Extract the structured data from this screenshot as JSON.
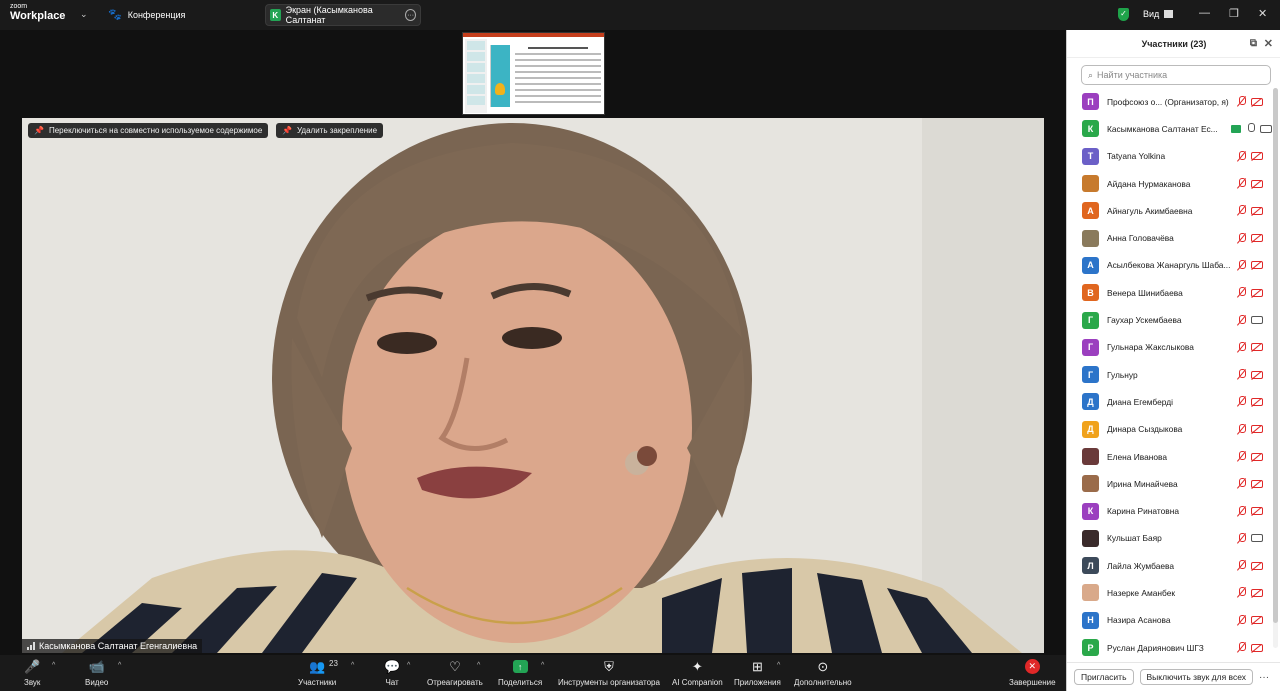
{
  "app": {
    "brand_top": "zoom",
    "brand_bottom": "Workplace",
    "meeting_label": "Конференция",
    "screen_tab_initial": "K",
    "screen_tab_label": "Экран (Касымканова Салтанат",
    "view_label": "Вид"
  },
  "video": {
    "switch_label": "Переключиться на совместно используемое содержимое",
    "unpin_label": "Удалить закрепление",
    "speaker_name": "Касымканова Салтанат Егенгалиевна"
  },
  "toolbar": {
    "audio": "Звук",
    "video": "Видео",
    "participants": "Участники",
    "participants_count": "23",
    "chat": "Чат",
    "react": "Отреагировать",
    "share": "Поделиться",
    "host_tools": "Инструменты организатора",
    "ai": "AI Companion",
    "apps": "Приложения",
    "more": "Дополнительно",
    "end": "Завершение"
  },
  "panel": {
    "title": "Участники (23)",
    "search_placeholder": "Найти участника",
    "invite": "Пригласить",
    "mute_all": "Выключить звук для всех",
    "participants": [
      {
        "initial": "П",
        "color": "#9b3fbf",
        "name": "Профсоюз о... (Организатор, я)",
        "mic": "off",
        "cam": "off"
      },
      {
        "initial": "К",
        "color": "#2aa84a",
        "name": "Касымканова Салтанат Ес...",
        "mic": "on",
        "cam": "on",
        "sharing": true
      },
      {
        "initial": "T",
        "color": "#6b5fc7",
        "name": "Tatyana Yolkina",
        "mic": "off",
        "cam": "off"
      },
      {
        "initial": "",
        "color": "#c77a2d",
        "name": "Айдана Нурмаканова",
        "mic": "off",
        "cam": "off",
        "photo": true
      },
      {
        "initial": "А",
        "color": "#e0661f",
        "name": "Айнагуль Акимбаевна",
        "mic": "off",
        "cam": "off"
      },
      {
        "initial": "",
        "color": "#8a7a5c",
        "name": "Анна Головачёва",
        "mic": "off",
        "cam": "off",
        "photo": true
      },
      {
        "initial": "А",
        "color": "#2c74c9",
        "name": "Асылбекова Жанаргуль Шаба...",
        "mic": "off",
        "cam": "off"
      },
      {
        "initial": "В",
        "color": "#e0661f",
        "name": "Венера Шинибаева",
        "mic": "off",
        "cam": "off"
      },
      {
        "initial": "Г",
        "color": "#2aa84a",
        "name": "Гаухар Ускембаева",
        "mic": "off",
        "cam": "on"
      },
      {
        "initial": "Г",
        "color": "#9b3fbf",
        "name": "Гульнара Жакслыкова",
        "mic": "off",
        "cam": "off"
      },
      {
        "initial": "Г",
        "color": "#2c74c9",
        "name": "Гульнур",
        "mic": "off",
        "cam": "off"
      },
      {
        "initial": "Д",
        "color": "#2c74c9",
        "name": "Диана Егемберді",
        "mic": "off",
        "cam": "off"
      },
      {
        "initial": "Д",
        "color": "#f0a21c",
        "name": "Динара Сыздыкова",
        "mic": "off",
        "cam": "off"
      },
      {
        "initial": "",
        "color": "#6a3a3a",
        "name": "Елена Иванова",
        "mic": "off",
        "cam": "off",
        "photo": true
      },
      {
        "initial": "",
        "color": "#9a6b4a",
        "name": "Ирина Минайчева",
        "mic": "off",
        "cam": "off",
        "photo": true
      },
      {
        "initial": "К",
        "color": "#9b3fbf",
        "name": "Карина Ринатовна",
        "mic": "off",
        "cam": "off"
      },
      {
        "initial": "",
        "color": "#3a2a2a",
        "name": "Кульшат Баяр",
        "mic": "off",
        "cam": "on",
        "photo": true
      },
      {
        "initial": "Л",
        "color": "#3c4a5a",
        "name": "Лайла Жумбаева",
        "mic": "off",
        "cam": "off"
      },
      {
        "initial": "",
        "color": "#d9a98a",
        "name": "Назерке Аманбек",
        "mic": "off",
        "cam": "off",
        "photo": true
      },
      {
        "initial": "Н",
        "color": "#2c74c9",
        "name": "Назира Асанова",
        "mic": "off",
        "cam": "off"
      },
      {
        "initial": "Р",
        "color": "#2aa84a",
        "name": "Руслан Дариянович ШГЗ",
        "mic": "off",
        "cam": "off"
      }
    ]
  }
}
